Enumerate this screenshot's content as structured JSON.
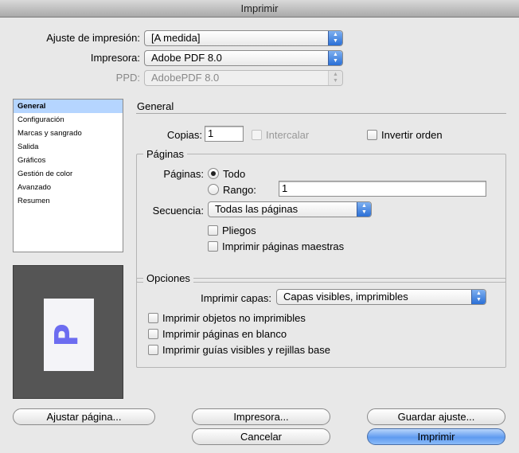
{
  "window": {
    "title": "Imprimir"
  },
  "top": {
    "preset_label": "Ajuste de impresión:",
    "preset_value": "[A medida]",
    "printer_label": "Impresora:",
    "printer_value": "Adobe PDF 8.0",
    "ppd_label": "PPD:",
    "ppd_value": "AdobePDF 8.0"
  },
  "sidebar": {
    "items": [
      {
        "label": "General",
        "selected": true
      },
      {
        "label": "Configuración"
      },
      {
        "label": "Marcas y sangrado"
      },
      {
        "label": "Salida"
      },
      {
        "label": "Gráficos"
      },
      {
        "label": "Gestión de color"
      },
      {
        "label": "Avanzado"
      },
      {
        "label": "Resumen"
      }
    ]
  },
  "preview": {
    "page_glyph": "P",
    "glyph_color": "#6c6cf0"
  },
  "general": {
    "title": "General",
    "copies_label": "Copias:",
    "copies_value": "1",
    "collate_label": "Intercalar",
    "reverse_label": "Invertir orden"
  },
  "pages": {
    "title": "Páginas",
    "pages_label": "Páginas:",
    "all_label": "Todo",
    "range_label": "Rango:",
    "range_value": "1",
    "sequence_label": "Secuencia:",
    "sequence_value": "Todas las páginas",
    "spreads_label": "Pliegos",
    "master_label": "Imprimir páginas maestras"
  },
  "options": {
    "title": "Opciones",
    "layers_label": "Imprimir capas:",
    "layers_value": "Capas visibles, imprimibles",
    "nonprint_label": "Imprimir objetos no imprimibles",
    "blank_label": "Imprimir páginas en blanco",
    "guides_label": "Imprimir guías visibles y rejillas base"
  },
  "buttons": {
    "page_setup": "Ajustar página...",
    "printer": "Impresora...",
    "save_preset": "Guardar ajuste...",
    "cancel": "Cancelar",
    "print": "Imprimir"
  },
  "colors": {
    "accent": "#5f9bf0",
    "selection": "#b5d5ff"
  }
}
